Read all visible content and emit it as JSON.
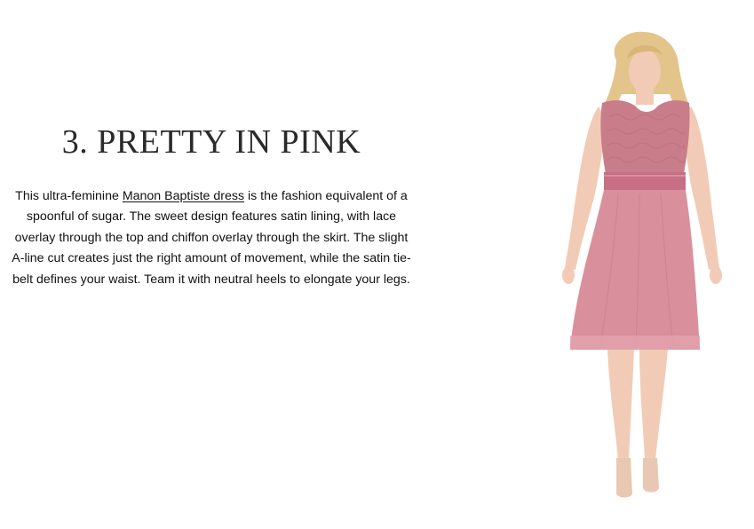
{
  "article": {
    "heading": "3. PRETTY IN PINK",
    "paragraph": {
      "before_link": "This ultra-feminine ",
      "link_text": "Manon Baptiste dress",
      "after_link": " is the fashion equivalent of a spoonful of sugar. The sweet design features satin lining, with lace overlay through the top and chiffon overlay through the skirt. The slight A-line cut creates just the right amount of movement, while the satin tie-belt defines your waist. Team it with neutral heels to elongate your legs."
    }
  },
  "image": {
    "subject": "model-in-pink-dress",
    "colors": {
      "dress": "#d9909c",
      "lace": "#c97d8b",
      "belt": "#c76f84",
      "skin": "#f2cbb6",
      "hair": "#e3c48a"
    }
  }
}
